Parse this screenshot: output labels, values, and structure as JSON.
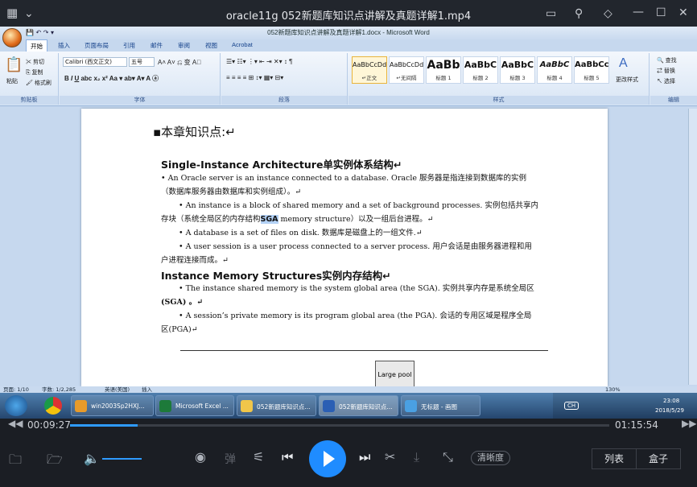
{
  "player": {
    "title": "oracle11g 052新题库知识点讲解及真题详解1.mp4",
    "current_time": "00:09:27",
    "total_time": "01:15:54",
    "progress_fraction": 0.125,
    "quality_label": "清晰度",
    "list_label": "列表",
    "box_label": "盒子",
    "danmu_label": "弹"
  },
  "word": {
    "title": "052新题库知识点讲解及真题详解1.docx - Microsoft Word",
    "tabs": [
      "开始",
      "插入",
      "页面布局",
      "引用",
      "邮件",
      "审阅",
      "视图",
      "Acrobat"
    ],
    "clipboard": {
      "paste": "粘贴",
      "cut": "剪切",
      "copy": "复制",
      "format_painter": "格式刷",
      "label": "剪贴板"
    },
    "font": {
      "name": "Calibri (西文正文)",
      "size": "五号",
      "label": "字体"
    },
    "paragraph_label": "段落",
    "styles": [
      {
        "preview": "AaBbCcDd",
        "name": "↵正文"
      },
      {
        "preview": "AaBbCcDd",
        "name": "↵无间隔"
      },
      {
        "preview": "AaBb",
        "name": "标题 1"
      },
      {
        "preview": "AaBbC",
        "name": "标题 2"
      },
      {
        "preview": "AaBbC",
        "name": "标题 3"
      },
      {
        "preview": "AaBbC",
        "name": "标题 4"
      },
      {
        "preview": "AaBbCc",
        "name": "标题 5"
      }
    ],
    "styles_label": "样式",
    "change_styles": "更改样式",
    "editing": {
      "find": "查找",
      "replace": "替换",
      "select": "选择",
      "label": "编辑"
    },
    "status": {
      "page": "页面: 1/10",
      "words": "字数: 1/2,285",
      "language": "英语(美国)",
      "mode": "插入",
      "zoom": "130%"
    }
  },
  "document": {
    "heading": "▪本章知识点:↵",
    "sec1_title": "Single-Instance Architecture单实例体系结构↵",
    "l1": "• An Oracle server is an instance connected to a database. Oracle 服务器是指连接到数据库的实例",
    "l2": "（数据库服务器由数据库和实例组成）。↵",
    "l3": "• An instance is a block of shared memory and a set of background processes. 实例包括共享内",
    "l4a": "存块（系统全局区的内存结构",
    "l4b": "SGA",
    "l4c": " memory structure）以及一组后台进程。↵",
    "l5": "• A database is a set of files on disk. 数据库是磁盘上的一组文件.↵",
    "l6": "• A user session is a user process connected to a server process. 用户会话是由服务器进程和用",
    "l7": "户进程连接而成。↵",
    "sec2_title": "Instance Memory Structures实例内存结构↵",
    "l8": "• The instance shared memory is the system global area (the SGA). 实例共享内存是系统全局区",
    "l9": "(SGA) 。↵",
    "l10": "• A session’s private memory is its program global area (the PGA). 会话的专用区域是程序全局",
    "l11": "区(PGA)↵",
    "diagram_label": "Large pool"
  },
  "taskbar": {
    "items": [
      "win2003Sp2HXJ...",
      "Microsoft Excel ...",
      "052新题库知识点...",
      "052新题库知识点...",
      "无标题 - 画图"
    ],
    "time": "23:08",
    "date": "2018/5/29",
    "ime": "CH"
  }
}
